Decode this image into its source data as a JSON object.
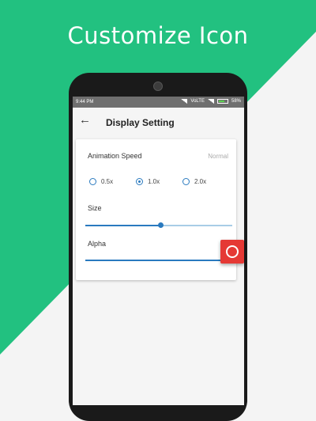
{
  "headline": "Customize Icon",
  "status_bar": {
    "time": "9:44 PM",
    "network": "VoLTE",
    "battery": "58%"
  },
  "app_bar": {
    "title": "Display Setting"
  },
  "settings": {
    "animation_speed_label": "Animation Speed",
    "animation_speed_value": "Normal",
    "speed_options": [
      "0.5x",
      "1.0x",
      "2.0x"
    ],
    "selected_speed": "1.0x",
    "size_label": "Size",
    "size_value_fraction": 0.51,
    "alpha_label": "Alpha",
    "alpha_value_fraction": 1.0
  },
  "colors": {
    "green": "#22c180",
    "accent": "#2a7abf",
    "fab": "#e53935"
  }
}
